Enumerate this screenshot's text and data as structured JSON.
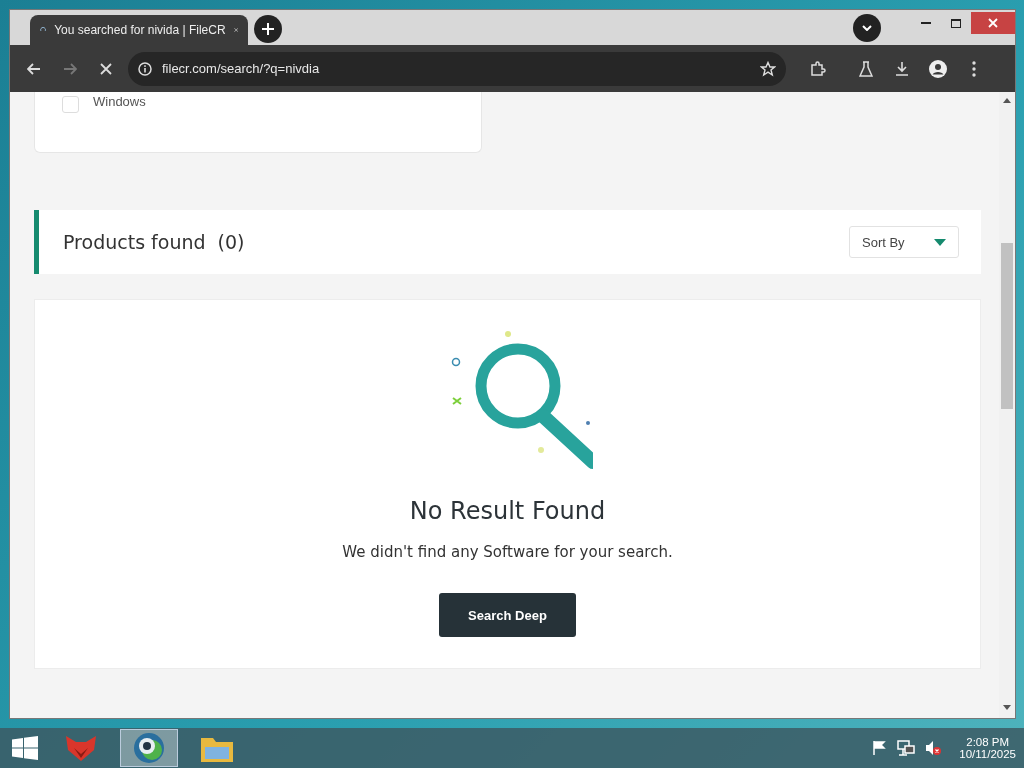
{
  "browser": {
    "tab": {
      "title": "You searched for nivida | FileCR"
    },
    "address": "filecr.com/search/?q=nivdia"
  },
  "filter": {
    "option": {
      "label": "Windows",
      "checked": false
    }
  },
  "results_header": {
    "title": "Products found",
    "count": "(0)",
    "sort": "Sort By"
  },
  "empty_state": {
    "title": "No Result Found",
    "message": "We didn't find any Software for your search.",
    "button": "Search Deep"
  },
  "taskbar": {
    "apps": [
      {
        "kind": "fox",
        "selected": false
      },
      {
        "kind": "browser",
        "selected": true
      },
      {
        "kind": "folder",
        "selected": false
      }
    ],
    "time": "2:08 PM",
    "date": "10/11/2025"
  }
}
